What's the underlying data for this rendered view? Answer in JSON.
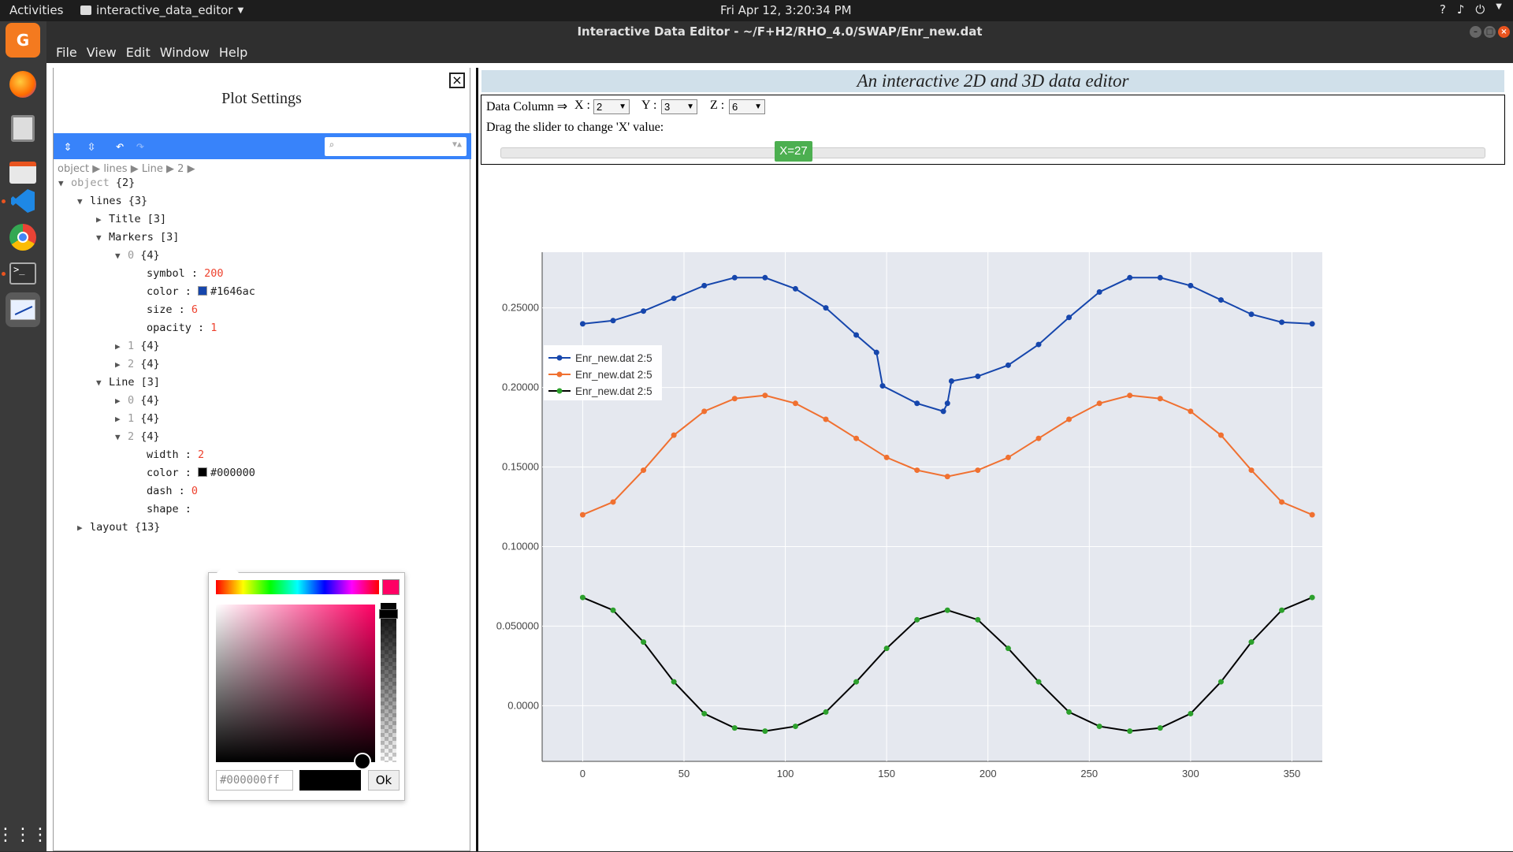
{
  "topbar": {
    "activities": "Activities",
    "app": "interactive_data_editor",
    "clock": "Fri Apr 12,  3:20:34 PM"
  },
  "window": {
    "title": "Interactive Data Editor - ~/F+H2/RHO_4.0/SWAP/Enr_new.dat"
  },
  "menu": {
    "file": "File",
    "view": "View",
    "edit": "Edit",
    "window": "Window",
    "help": "Help"
  },
  "settings": {
    "title": "Plot Settings",
    "breadcrumb": "object ▶ lines ▶ Line ▶ 2 ▶",
    "search_placeholder": "",
    "tree": {
      "object": "object",
      "object_count": "{2}",
      "lines": "lines",
      "lines_count": "{3}",
      "title": "Title",
      "title_count": "[3]",
      "markers": "Markers",
      "markers_count": "[3]",
      "m0": "0",
      "m0_count": "{4}",
      "symbol_k": "symbol",
      "symbol_v": "200",
      "mcolor_k": "color",
      "mcolor_v": "#1646ac",
      "size_k": "size",
      "size_v": "6",
      "opacity_k": "opacity",
      "opacity_v": "1",
      "m1": "1",
      "m1_count": "{4}",
      "m2": "2",
      "m2_count": "{4}",
      "line": "Line",
      "line_count": "[3]",
      "l0": "0",
      "l0_count": "{4}",
      "l1": "1",
      "l1_count": "{4}",
      "l2": "2",
      "l2_count": "{4}",
      "width_k": "width",
      "width_v": "2",
      "lcolor_k": "color",
      "lcolor_v": "#000000",
      "dash_k": "dash",
      "dash_v": "0",
      "shape_k": "shape",
      "layout": "layout",
      "layout_count": "{13}"
    },
    "picker": {
      "hex": "#000000ff",
      "ok": "Ok"
    }
  },
  "editor": {
    "banner": "An interactive 2D and 3D data editor",
    "data_column": "Data Column ⇒",
    "x_label": "X :",
    "x_value": "2",
    "y_label": "Y :",
    "y_value": "3",
    "z_label": "Z :",
    "z_value": "6",
    "drag_text": "Drag the slider to change 'X' value:",
    "slider_label": "X=27"
  },
  "colors": {
    "accent": "#3883fa",
    "series1": "#1646ac",
    "series2": "#f07030",
    "series3": "#000000",
    "series3_marker": "#2ca02c"
  },
  "chart_data": {
    "type": "line",
    "title": "",
    "xlabel": "",
    "ylabel": "",
    "xlim": [
      -20,
      365
    ],
    "ylim": [
      -0.035,
      0.285
    ],
    "xticks": [
      0,
      50,
      100,
      150,
      200,
      250,
      300,
      350
    ],
    "yticks": [
      0.0,
      0.05,
      0.1,
      0.15,
      0.2,
      0.25
    ],
    "ytick_labels": [
      "0.0000",
      "0.050000",
      "0.10000",
      "0.15000",
      "0.20000",
      "0.25000"
    ],
    "grid": true,
    "legend": "top-left",
    "series": [
      {
        "name": "Enr_new.dat 2:5",
        "x": [
          0,
          15,
          30,
          45,
          60,
          75,
          90,
          105,
          120,
          135,
          145,
          148,
          165,
          178,
          180,
          182,
          195,
          210,
          225,
          240,
          255,
          270,
          285,
          300,
          315,
          330,
          345,
          360
        ],
        "y": [
          0.24,
          0.242,
          0.248,
          0.256,
          0.264,
          0.269,
          0.269,
          0.262,
          0.25,
          0.233,
          0.222,
          0.201,
          0.19,
          0.185,
          0.19,
          0.204,
          0.207,
          0.214,
          0.227,
          0.244,
          0.26,
          0.269,
          0.269,
          0.264,
          0.255,
          0.246,
          0.241,
          0.24
        ]
      },
      {
        "name": "Enr_new.dat 2:5",
        "x": [
          0,
          15,
          30,
          45,
          60,
          75,
          90,
          105,
          120,
          135,
          150,
          165,
          180,
          195,
          210,
          225,
          240,
          255,
          270,
          285,
          300,
          315,
          330,
          345,
          360
        ],
        "y": [
          0.12,
          0.128,
          0.148,
          0.17,
          0.185,
          0.193,
          0.195,
          0.19,
          0.18,
          0.168,
          0.156,
          0.148,
          0.144,
          0.148,
          0.156,
          0.168,
          0.18,
          0.19,
          0.195,
          0.193,
          0.185,
          0.17,
          0.148,
          0.128,
          0.12
        ]
      },
      {
        "name": "Enr_new.dat 2:5",
        "x": [
          0,
          15,
          30,
          45,
          60,
          75,
          90,
          105,
          120,
          135,
          150,
          165,
          180,
          195,
          210,
          225,
          240,
          255,
          270,
          285,
          300,
          315,
          330,
          345,
          360
        ],
        "y": [
          0.068,
          0.06,
          0.04,
          0.015,
          -0.005,
          -0.014,
          -0.016,
          -0.013,
          -0.004,
          0.015,
          0.036,
          0.054,
          0.06,
          0.054,
          0.036,
          0.015,
          -0.004,
          -0.013,
          -0.016,
          -0.014,
          -0.005,
          0.015,
          0.04,
          0.06,
          0.068
        ]
      }
    ]
  }
}
